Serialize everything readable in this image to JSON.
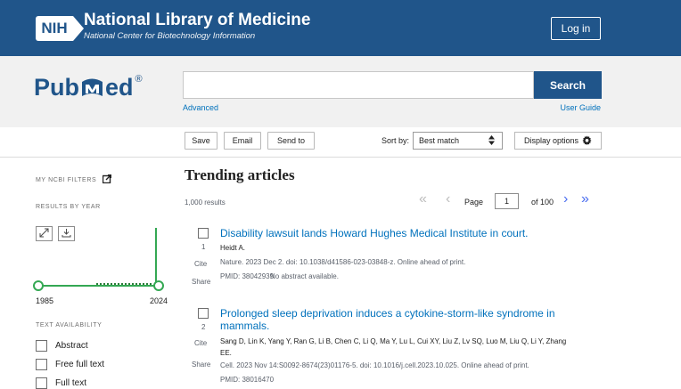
{
  "header": {
    "org_badge": "NIH",
    "org_title": "National Library of Medicine",
    "org_subtitle": "National Center for Biotechnology Information",
    "login_label": "Log in"
  },
  "search": {
    "logo_text_left": "Pub",
    "logo_text_right": "ed",
    "logo_mark": "®",
    "input_value": "",
    "button_label": "Search",
    "advanced_label": "Advanced",
    "user_guide_label": "User Guide"
  },
  "toolbar": {
    "save_label": "Save",
    "email_label": "Email",
    "send_to_label": "Send to",
    "sort_by_label": "Sort by:",
    "sort_value": "Best match",
    "display_options_label": "Display options"
  },
  "sidebar": {
    "my_ncbi_filters_label": "MY NCBI FILTERS",
    "results_by_year_label": "RESULTS BY YEAR",
    "year_start": "1985",
    "year_end": "2024",
    "text_availability_label": "TEXT AVAILABILITY",
    "filters": [
      {
        "label": "Abstract"
      },
      {
        "label": "Free full text"
      },
      {
        "label": "Full text"
      }
    ]
  },
  "results": {
    "heading": "Trending articles",
    "count_text": "1,000 results",
    "page_label": "Page",
    "page_value": "1",
    "of_pages_label": "of 100",
    "articles": [
      {
        "num": "1",
        "title_line1": "Disability lawsuit lands Howard Hughes Medical Institute in court.",
        "title_line2": "",
        "authors_line1": "Heidt A.",
        "authors_line2": "",
        "citation": "Nature. 2023 Dec 2. doi: 10.1038/d41586-023-03848-z. Online ahead of print.",
        "pmid": "PMID: 38042939",
        "note": "No abstract available.",
        "cite_label": "Cite",
        "share_label": "Share"
      },
      {
        "num": "2",
        "title_line1": "Prolonged sleep deprivation induces a cytokine-storm-like syndrome in",
        "title_line2": "mammals.",
        "authors_line1": "Sang D, Lin K, Yang Y, Ran G, Li B, Chen C, Li Q, Ma Y, Lu L, Cui XY, Liu Z, Lv SQ, Luo M, Liu Q, Li Y, Zhang",
        "authors_line2": "EE.",
        "citation": "Cell. 2023 Nov 14:S0092-8674(23)01176-5. doi: 10.1016/j.cell.2023.10.025. Online ahead of print.",
        "pmid": "PMID: 38016470",
        "note": "",
        "cite_label": "Cite",
        "share_label": "Share"
      }
    ]
  },
  "colors": {
    "nih_blue": "#20558a",
    "link_blue": "#0071bc",
    "timeline_green": "#34a853",
    "pager_active": "#4a6df0",
    "pager_inactive": "#bcbcbc"
  },
  "icons": {
    "external": "external-link-icon",
    "expand": "expand-icon",
    "download": "download-icon",
    "gear": "gear-icon",
    "sort": "sort-arrows-icon"
  }
}
